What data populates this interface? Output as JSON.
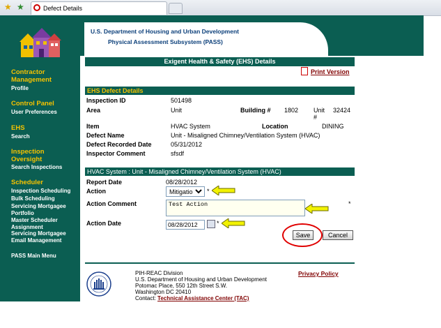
{
  "browser": {
    "tab_title": "Defect Details"
  },
  "header": {
    "line1": "U.S. Department of Housing and Urban Development",
    "line2": "Physical Assessment Subsystem (PASS)"
  },
  "sidebar": {
    "contractor": "Contractor Management",
    "profile": "Profile",
    "control_panel": "Control Panel",
    "user_prefs": "User Preferences",
    "ehs": "EHS",
    "search": "Search",
    "inspection_oversight": "Inspection Oversight",
    "search_inspections": "Search Inspections",
    "scheduler": "Scheduler",
    "inspection_scheduling": "Inspection Scheduling",
    "bulk_scheduling": "Bulk Scheduling",
    "servicing_mortgagee_portfolio": "Servicing Mortgagee Portfolio",
    "master_scheduler_assignment": "Master Scheduler Assignment",
    "servicing_mortgagee_email": "Servicing Mortgagee Email Management",
    "pass_main_menu": "PASS Main Menu"
  },
  "page": {
    "title": "Exigent Health & Safety (EHS) Details",
    "print_version": "Print Version"
  },
  "defect": {
    "section_title": "EHS Defect Details",
    "inspection_id_label": "Inspection ID",
    "inspection_id": "501498",
    "area_label": "Area",
    "area": "Unit",
    "building_label": "Building #",
    "building": "1802",
    "unit_label": "Unit #",
    "unit": "32424",
    "item_label": "Item",
    "item": "HVAC System",
    "location_label": "Location",
    "location": "DINING",
    "defect_name_label": "Defect Name",
    "defect_name": "Unit - Misaligned Chimney/Ventilation System (HVAC)",
    "recorded_date_label": "Defect Recorded Date",
    "recorded_date": "05/31/2012",
    "inspector_comment_label": "Inspector Comment",
    "inspector_comment": "sfsdf"
  },
  "action": {
    "section_title": "HVAC System : Unit - Misaligned Chimney/Ventilation System (HVAC)",
    "report_date_label": "Report Date",
    "report_date": "08/28/2012",
    "action_label": "Action",
    "action_selected": "Mitigation",
    "action_comment_label": "Action Comment",
    "action_comment": "Test Action",
    "action_date_label": "Action Date",
    "action_date": "08/28/2012",
    "required_mark": "*",
    "save": "Save",
    "cancel": "Cancel"
  },
  "footer": {
    "division": "PIH-REAC Division",
    "dept": "U.S. Department of Housing and Urban Development",
    "address1": "Potomac Place, 550 12th Street S.W.",
    "address2": "Washington DC 20410",
    "contact": "Contact:",
    "tac": "Technical Assistance Center (TAC)",
    "privacy": "Privacy Policy"
  },
  "colors": {
    "teal": "#0b5e52",
    "gold": "#f6c200",
    "maroon": "#800000",
    "highlight_arrow": "#f2f200",
    "ring": "#e00000"
  }
}
